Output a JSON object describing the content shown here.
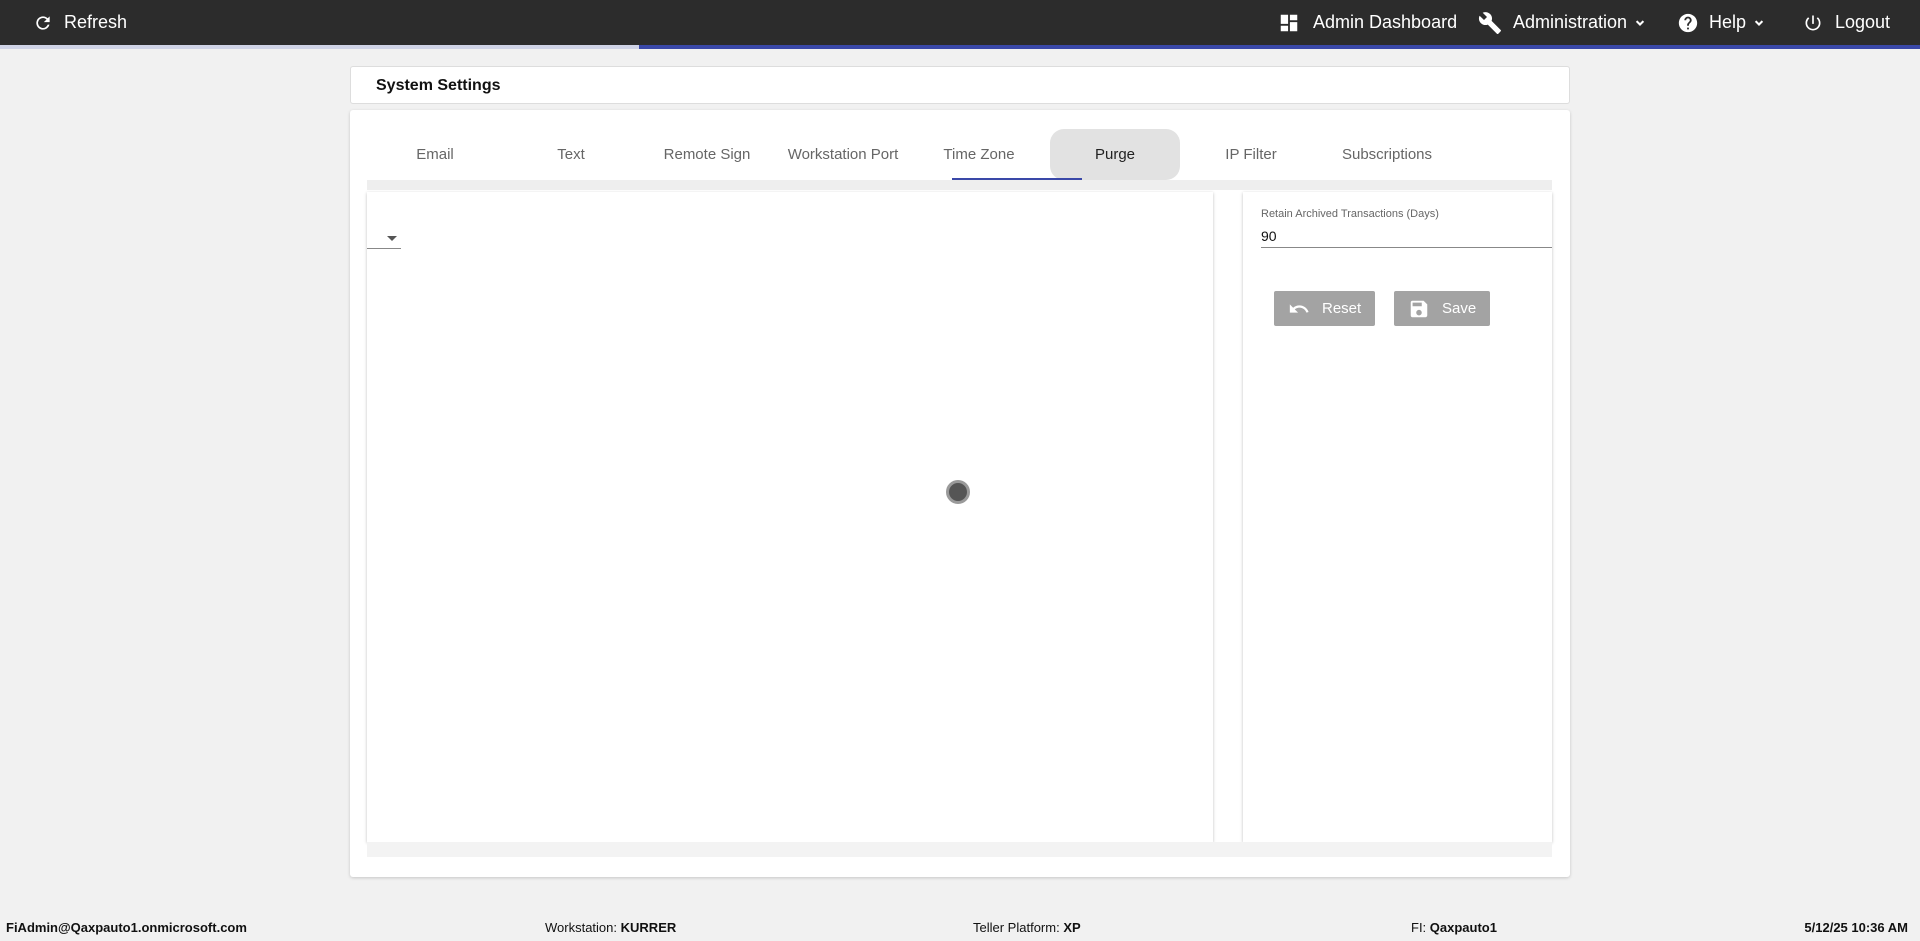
{
  "topbar": {
    "refresh_label": "Refresh",
    "dashboard_label": "Admin Dashboard",
    "administration_label": "Administration",
    "help_label": "Help",
    "logout_label": "Logout",
    "progress_fraction": 0.667,
    "colors": {
      "bar": "#2c2c2c",
      "accent": "#3a48a8"
    },
    "icons": [
      "refresh-icon",
      "dashboard-icon",
      "wrench-icon",
      "help-icon",
      "power-icon",
      "chevron-down-icon"
    ]
  },
  "page": {
    "title": "System Settings"
  },
  "tabs": [
    {
      "label": "Email"
    },
    {
      "label": "Text"
    },
    {
      "label": "Remote Sign"
    },
    {
      "label": "Workstation Port"
    },
    {
      "label": "Time Zone"
    },
    {
      "label": "Purge"
    },
    {
      "label": "IP Filter"
    },
    {
      "label": "Subscriptions"
    }
  ],
  "active_tab": "Purge",
  "purge": {
    "field_label": "Retain Archived Transactions (Days)",
    "field_value": "90",
    "reset_label": "Reset",
    "save_label": "Save",
    "button_color": "#a3a3a3"
  },
  "status": {
    "user": "FiAdmin@Qaxpauto1.onmicrosoft.com",
    "workstation_label": "Workstation:",
    "workstation_value": "KURRER",
    "teller_platform_label": "Teller Platform:",
    "teller_platform_value": "XP",
    "fi_label": "FI:",
    "fi_value": "Qaxpauto1",
    "datetime": "5/12/25 10:36 AM"
  }
}
